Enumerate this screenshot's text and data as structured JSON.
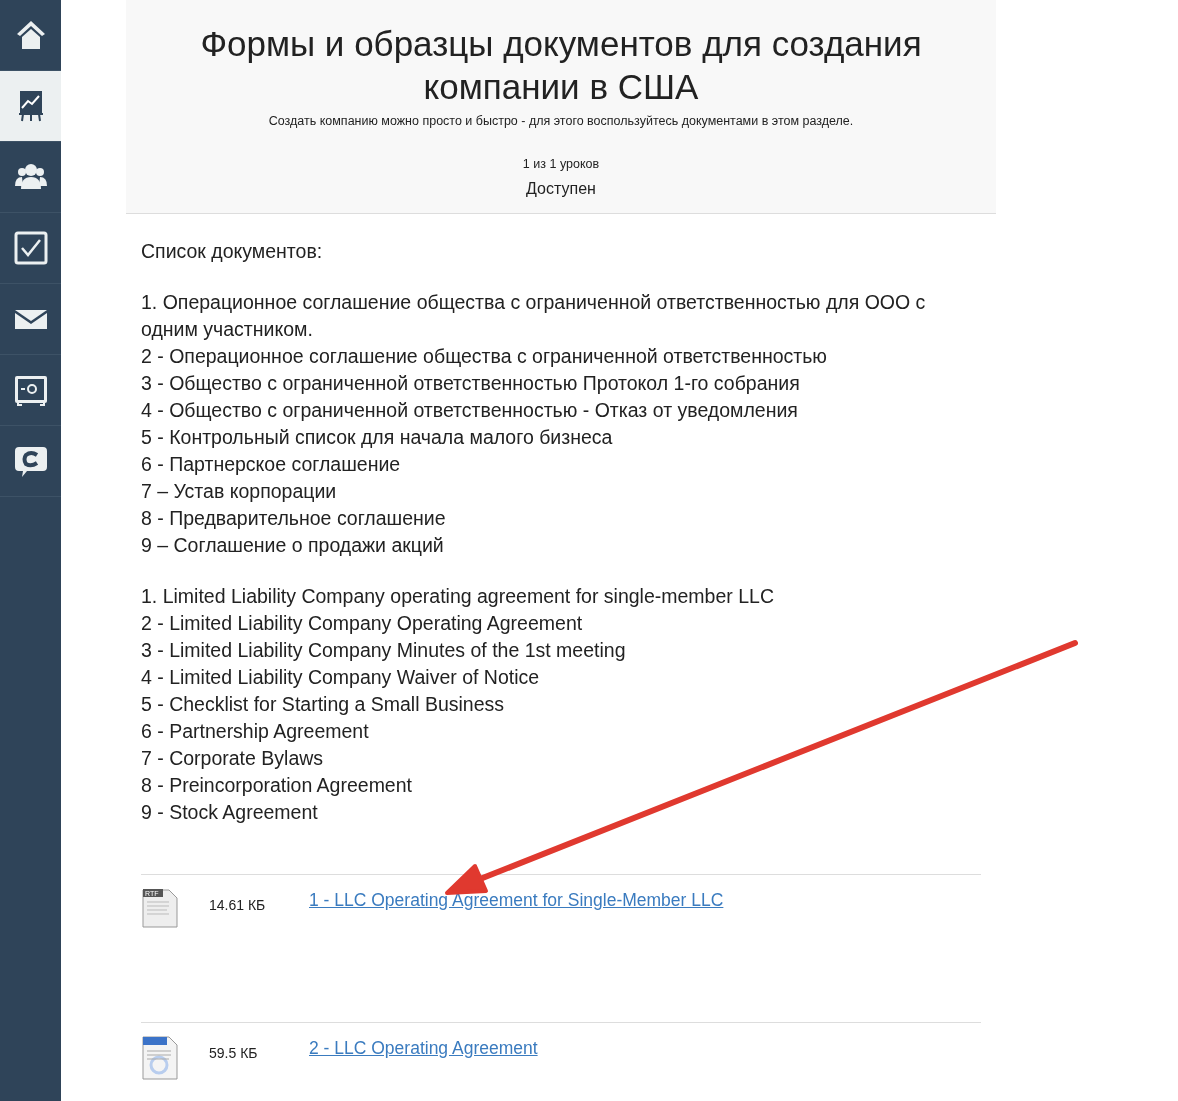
{
  "sidebar": {
    "items": [
      {
        "selected": false
      },
      {
        "selected": true
      },
      {
        "selected": false
      },
      {
        "selected": false
      },
      {
        "selected": false
      },
      {
        "selected": false
      },
      {
        "selected": false
      }
    ]
  },
  "header": {
    "title": "Формы и образцы документов для создания компании в США",
    "subtitle": "Создать компанию можно просто и быстро - для этого воспользуйтесь документами в этом разделе.",
    "progress": "1 из 1 уроков",
    "status": "Доступен"
  },
  "content": {
    "heading": "Список документов:",
    "lists": [
      [
        "1. Операционное соглашение общества с ограниченной ответственностью для ООО с одним участником.",
        "2 - Операционное соглашение общества с ограниченной ответственностью",
        "3 - Общество с ограниченной ответственностью Протокол 1-го собрания",
        "4 - Общество с ограниченной ответственностью  - Отказ от уведомления",
        "5 - Контрольный список для начала малого бизнеса",
        "6 - Партнерское соглашение",
        "7 –  Устав корпорации",
        "8 - Предварительное соглашение",
        "9 –  Соглашение о продажи акций"
      ],
      [
        "1.  Limited Liability Company operating agreement for single-member LLC",
        "2 - Limited Liability Company Operating Agreement",
        "3 - Limited Liability Company Minutes of the  1st meeting",
        "4 - Limited Liability Company Waiver of Notice",
        "5 - Checklist for Starting a Small Business",
        "6 - Partnership Agreement",
        "7 - Corporate Bylaws",
        "8 - Preincorporation Agreement",
        "9 - Stock Agreement"
      ]
    ]
  },
  "files": [
    {
      "kind": "rtf",
      "badge": "RTF",
      "size": "14.61 КБ",
      "link": "1 - LLC Operating Agreement for Single-Member LLC"
    },
    {
      "kind": "word",
      "size": "59.5 КБ",
      "link": "2 - LLC Operating Agreement"
    }
  ],
  "annotation": {
    "kind": "arrow",
    "color": "#e0392f"
  }
}
